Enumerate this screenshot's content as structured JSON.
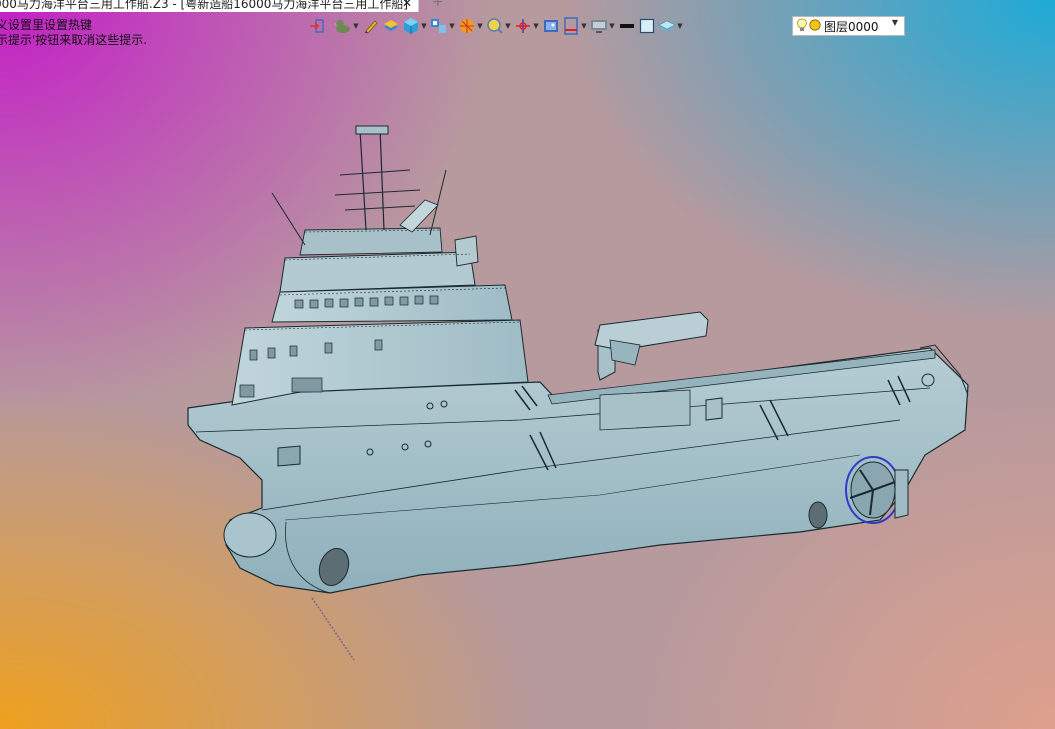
{
  "window": {
    "tab_title": "000马力海洋平台三用工作船.Z3 - [粤新造船16000马力海洋平台三用工作船]",
    "tab_close": "✕",
    "new_tab": "+"
  },
  "hints": {
    "line1": "义设置里设置热键",
    "line2": "示提示'按钮来取消这些提示."
  },
  "toolbar": {
    "tools": [
      {
        "icon": "exit-icon",
        "has_menu": false
      },
      {
        "icon": "duck-icon",
        "has_menu": true
      },
      {
        "icon": "pen-icon",
        "has_menu": false
      },
      {
        "icon": "layers-icon",
        "has_menu": false
      },
      {
        "icon": "cube-icon",
        "has_menu": true
      },
      {
        "icon": "views-icon",
        "has_menu": true
      },
      {
        "icon": "sphere-icon",
        "has_menu": true
      },
      {
        "icon": "zoom-icon",
        "has_menu": true
      },
      {
        "icon": "axis-icon",
        "has_menu": true
      },
      {
        "icon": "image-icon",
        "has_menu": false
      },
      {
        "icon": "section-icon",
        "has_menu": true
      },
      {
        "icon": "monitor-icon",
        "has_menu": true
      },
      {
        "icon": "line-weight-icon",
        "has_menu": false
      },
      {
        "icon": "color-swatch-icon",
        "has_menu": false
      },
      {
        "icon": "plane-icon",
        "has_menu": true
      }
    ],
    "layer": {
      "name": "图层0000",
      "bulb_icon": "lightbulb-icon",
      "dot_icon": "layer-color-dot-icon"
    }
  },
  "colors": {
    "hull": "#a9c4cc",
    "outline": "#1b2a2e",
    "propeller_ring": "#2f3cc9",
    "layer_dot": "#f3c316"
  }
}
